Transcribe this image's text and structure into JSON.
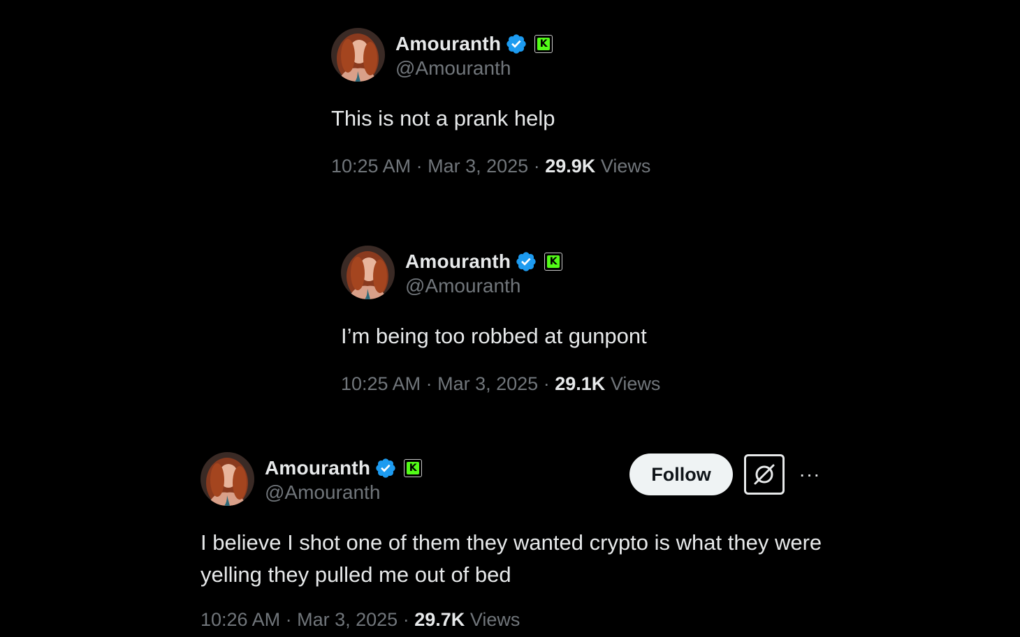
{
  "tweets": [
    {
      "display_name": "Amouranth",
      "handle": "@Amouranth",
      "text": "This is not a prank help",
      "time": "10:25 AM",
      "date": "Mar 3, 2025",
      "views_count": "29.9K",
      "views_label": "Views"
    },
    {
      "display_name": "Amouranth",
      "handle": "@Amouranth",
      "text": "I’m being too robbed at gunpont",
      "time": "10:25 AM",
      "date": "Mar 3, 2025",
      "views_count": "29.1K",
      "views_label": "Views"
    },
    {
      "display_name": "Amouranth",
      "handle": "@Amouranth",
      "text": "I believe I shot one of them they wanted crypto is what they were yelling they pulled me out of bed",
      "time": "10:26 AM",
      "date": "Mar 3, 2025",
      "views_count": "29.7K",
      "views_label": "Views",
      "follow_label": "Follow",
      "more_label": "···"
    }
  ],
  "separator": "·",
  "affiliate_badge_letter": "K",
  "icons": [
    "verified-badge-icon",
    "kick-affiliate-icon",
    "grok-icon",
    "more-icon"
  ],
  "colors": {
    "background": "#000000",
    "primary_text": "#e7e9ea",
    "secondary_text": "#71767b",
    "verified_blue": "#1d9bf0",
    "kick_green": "#53fc18",
    "follow_bg": "#eff3f4"
  }
}
